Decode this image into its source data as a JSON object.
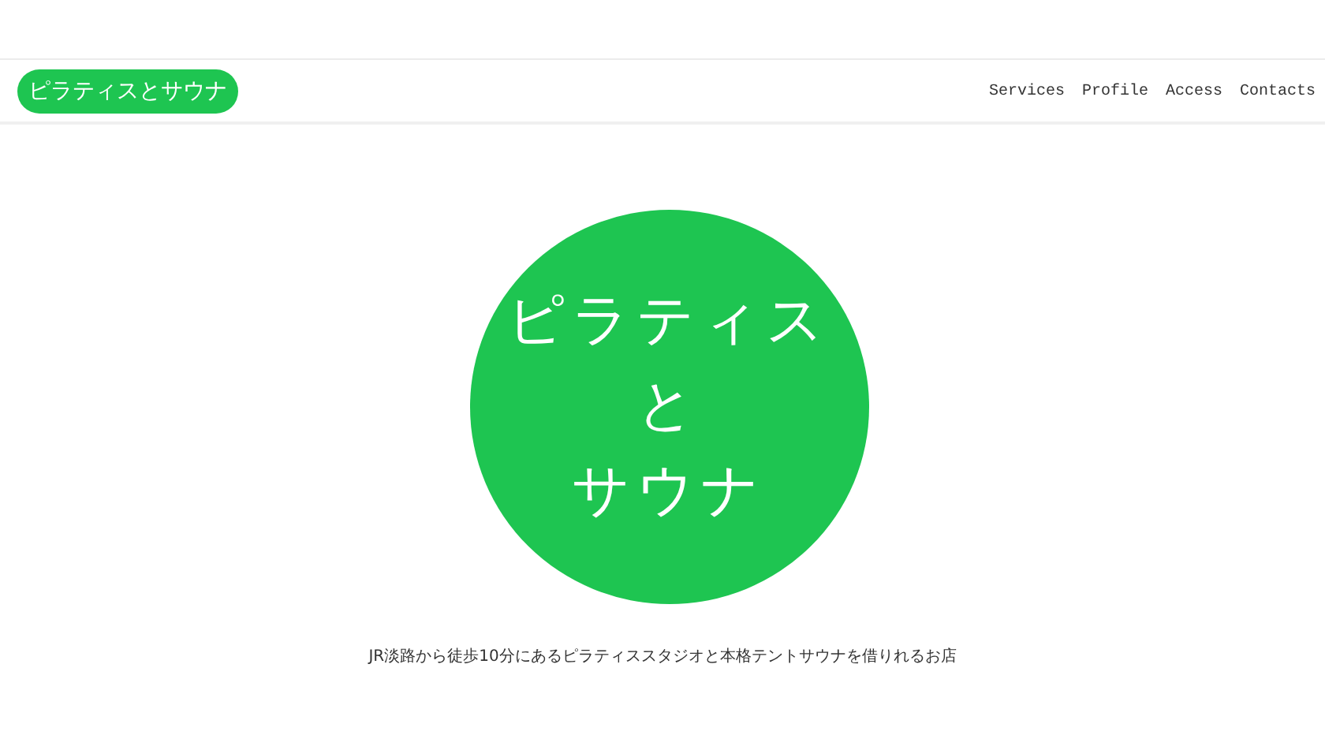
{
  "header": {
    "logo": "ピラティスとサウナ",
    "nav": [
      {
        "label": "Services"
      },
      {
        "label": "Profile"
      },
      {
        "label": "Access"
      },
      {
        "label": "Contacts"
      }
    ]
  },
  "hero": {
    "title_lines": [
      "ピラティス",
      "と",
      "サウナ"
    ],
    "caption": "JR淡路から徒歩10分にあるピラティススタジオと本格テントサウナを借りれるお店"
  }
}
